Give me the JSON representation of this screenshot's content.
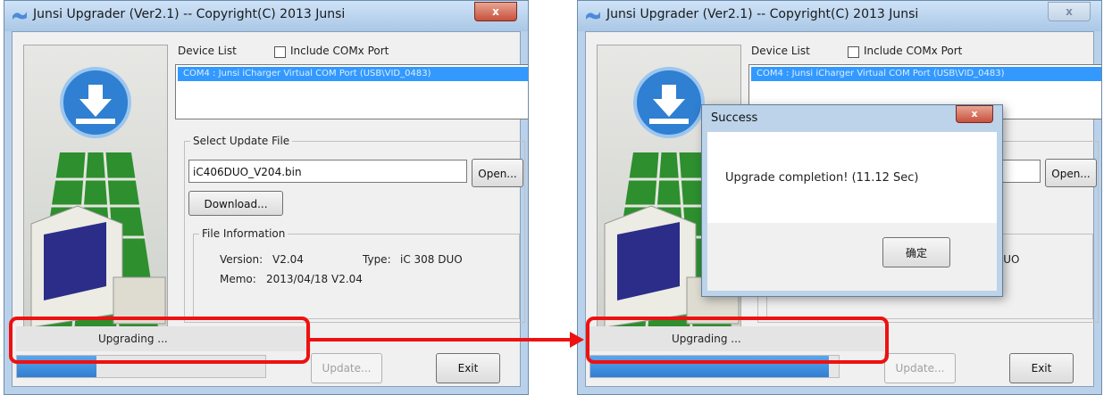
{
  "left_window": {
    "title": "Junsi Upgrader (Ver2.1) -- Copyright(C) 2013 Junsi",
    "close_label": "x",
    "device_list_label": "Device List",
    "include_com_label": "Include COMx Port",
    "device_entry": "COM4 : Junsi iCharger Virtual COM Port (USB\\VID_0483)",
    "select_update_file_label": "Select Update File",
    "file_path_value": "iC406DUO_V204.bin",
    "open_button": "Open...",
    "download_button": "Download...",
    "file_info_label": "File Information",
    "version_label": "Version:",
    "version_value": "V2.04",
    "type_label": "Type:",
    "type_value": "iC 308 DUO",
    "memo_label": "Memo:",
    "memo_value": "2013/04/18 V2.04",
    "status_text": "Upgrading ...",
    "progress_fraction": 0.32,
    "update_button": "Update...",
    "exit_button": "Exit"
  },
  "right_window": {
    "title": "Junsi Upgrader (Ver2.1) -- Copyright(C) 2013 Junsi",
    "close_label": "x",
    "device_list_label": "Device List",
    "include_com_label": "Include COMx Port",
    "device_entry": "COM4 : Junsi iCharger Virtual COM Port (USB\\VID_0483)",
    "open_button": "Open...",
    "type_value_partial": "DUO",
    "status_text": "Upgrading ...",
    "progress_fraction": 0.96,
    "update_button": "Update...",
    "exit_button": "Exit"
  },
  "dialog": {
    "title": "Success",
    "close_label": "x",
    "message": "Upgrade completion! (11.12 Sec)",
    "ok_button": "确定"
  },
  "colors": {
    "annotation": "#ee1111",
    "progress": "#2f7fd2",
    "selection": "#3399ff"
  }
}
